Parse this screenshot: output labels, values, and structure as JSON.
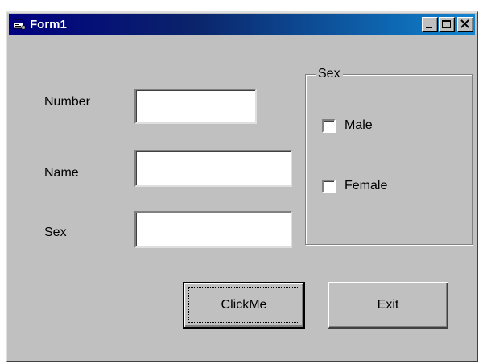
{
  "window": {
    "title": "Form1",
    "title_icon": "form-app-icon",
    "titlebar_colors": [
      "#000080",
      "#1084d0"
    ],
    "controls": [
      "minimize-icon",
      "maximize-icon",
      "close-icon"
    ]
  },
  "form": {
    "number_label": "Number",
    "number_value": "",
    "name_label": "Name",
    "name_value": "",
    "sex_label": "Sex",
    "sex_value": ""
  },
  "sex_group": {
    "legend": "Sex",
    "options": [
      {
        "label": "Male",
        "checked": false
      },
      {
        "label": "Female",
        "checked": false
      }
    ]
  },
  "buttons": {
    "clickme": "ClickMe",
    "exit": "Exit"
  }
}
